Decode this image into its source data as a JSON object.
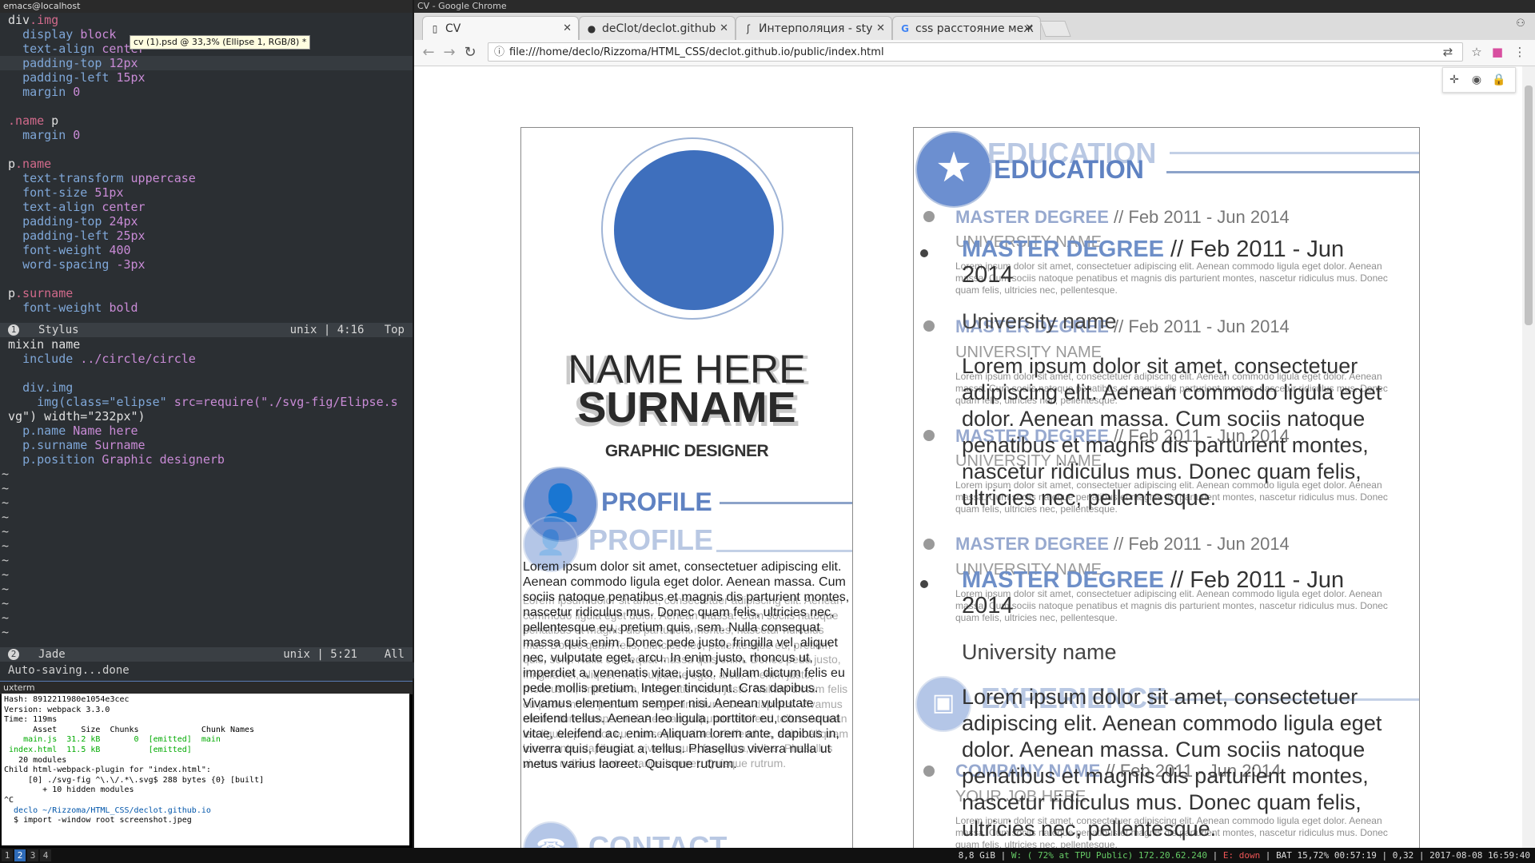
{
  "emacs": {
    "title": "emacs@localhost",
    "tooltip": "cv (1).psd @ 33,3% (Ellipse 1, RGB/8) *",
    "stylus_lines": [
      "div.img",
      "  display block",
      "  text-align center",
      "  padding-top 12px",
      "  padding-left 15px",
      "  margin 0",
      "",
      ".name p",
      "  margin 0",
      "",
      "p.name",
      "  text-transform uppercase",
      "  font-size 51px",
      "  text-align center",
      "  padding-top 24px",
      "  padding-left 25px",
      "  font-weight 400",
      "  word-spacing -3px",
      "",
      "p.surname",
      "  font-weight bold"
    ],
    "modeline1": {
      "num": "1",
      "mode": "Stylus",
      "enc": "unix",
      "pos": "4:16",
      "scroll": "Top"
    },
    "jade_lines": [
      "mixin name",
      "  include ../circle/circle",
      "",
      "  div.img",
      "    img(class=\"elipse\" src=require(\"./svg-fig/Elipse.s",
      "vg\") width=\"232px\")",
      "  p.name Name here",
      "  p.surname Surname",
      "  p.position Graphic designerb"
    ],
    "tilde": "~",
    "modeline2": {
      "num": "2",
      "mode": "Jade",
      "enc": "unix",
      "pos": "5:21",
      "scroll": "All"
    },
    "minibuffer": "Auto-saving...done"
  },
  "uxterm": {
    "title": "uxterm",
    "lines": [
      "Hash: 8912211980e1054e3cec",
      "Version: webpack 3.3.0",
      "Time: 119ms",
      "      Asset     Size  Chunks             Chunk Names",
      "    main.js  31.2 kB       0  [emitted]  main",
      " index.html  11.5 kB          [emitted]",
      "   20 modules",
      "Child html-webpack-plugin for \"index.html\":",
      "     [0] ./svg-fig ^\\.\\/.*\\.svg$ 288 bytes {0} [built]",
      "        + 10 hidden modules",
      "^C",
      "  declo ~/Rizzoma/HTML_CSS/declot.github.io",
      "  $ import -window root screenshot.jpeg"
    ]
  },
  "chrome": {
    "title": "CV - Google Chrome",
    "tabs": [
      {
        "label": "CV",
        "icon": "page-icon",
        "active": true
      },
      {
        "label": "deClot/declot.github",
        "icon": "github-icon",
        "active": false
      },
      {
        "label": "Интерполяция - sty",
        "icon": "stylus-icon",
        "active": false
      },
      {
        "label": "css расстояние меж",
        "icon": "google-icon",
        "active": false
      }
    ],
    "url": "file:///home/declo/Rizzoma/HTML_CSS/declot.github.io/public/index.html"
  },
  "cv": {
    "name": "NAME HERE",
    "surname": "SURNAME",
    "position": "GRAPHIC DESIGNER",
    "profile_heading": "PROFILE",
    "profile_text": "Lorem ipsum dolor sit amet, consectetuer adipiscing elit. Aenean commodo ligula eget dolor. Aenean massa. Cum sociis natoque penatibus et magnis dis parturient montes, nascetur ridiculus mus. Donec quam felis, ultricies nec, pellentesque eu, pretium quis, sem. Nulla consequat massa quis enim. Donec pede justo, fringilla vel, aliquet nec, vulputate eget, arcu. In enim justo, rhoncus ut, imperdiet a, venenatis vitae, justo. Nullam dictum felis eu pede mollis pretium. Integer tincidunt. Cras dapibus. Vivamus elementum semper nisi. Aenean vulputate eleifend tellus. Aenean leo ligula, porttitor eu, consequat vitae, eleifend ac, enim. Aliquam lorem ante, dapibus in, viverra quis, feugiat a, tellus. Phasellus viverra nulla ut metus varius laoreet. Quisque rutrum.",
    "contact_heading": "CONTACT",
    "education_heading": "EDUCATION",
    "degree": "MASTER DEGREE",
    "degree_date": "// Feb 2011 - Jun 2014",
    "degree_date_wrapped": "// Feb 2011 - Jun",
    "year_wrap": "2014",
    "university_caps": "UNIVERSITY NAME",
    "university": "University name",
    "edu_text": "Lorem ipsum dolor sit amet, consectetuer adipiscing elit. Aenean commodo ligula eget dolor. Aenean massa. Cum sociis natoque penatibus et magnis dis parturient montes, nascetur ridiculus mus. Donec quam felis, ultricies nec, pellentesque.",
    "edu_text_big": "Lorem ipsum dolor sit amet, consectetuer adipiscing elit. Aenean commodo ligula eget dolor. Aenean massa. Cum sociis natoque penatibus et magnis dis parturient montes, nascetur ridiculus mus. Donec quam felis, ultricies nec, pellentesque.",
    "experience_heading": "EXPERIENCE",
    "company": "COMPANY NAME",
    "job": "YOUR JOB HERE"
  },
  "panel": {
    "workspaces": [
      "1",
      "2",
      "3",
      "4"
    ],
    "active_ws": "2",
    "mem": "8,8 GiB",
    "wifi": "W: ( 72% at TPU Public) 172.20.62.240",
    "eth": "E: down",
    "bat": "BAT 15,72% 00:57:19",
    "load": "0,32",
    "datetime": "2017-08-08 16:59:40"
  },
  "colors": {
    "accent": "#3e6fbd",
    "heading": "#5f82c2"
  }
}
